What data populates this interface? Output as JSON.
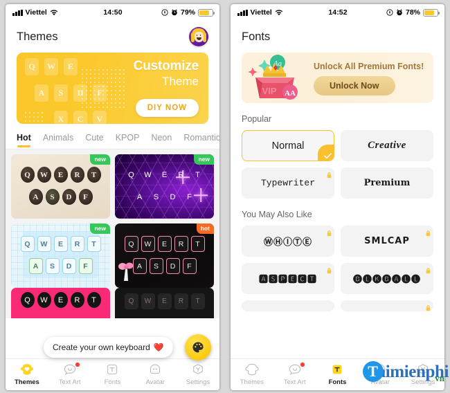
{
  "themes_screen": {
    "status_bar": {
      "carrier": "Viettel",
      "time": "14:50",
      "battery_pct": "79%",
      "icons": [
        "signal-bars-icon",
        "wifi-icon",
        "location-icon",
        "alarm-icon",
        "battery-icon"
      ]
    },
    "page_title": "Themes",
    "avatar_name": "user-avatar",
    "banner": {
      "title": "Customize",
      "subtitle": "Theme",
      "button": "DIY NOW",
      "keys_row1": [
        "Q",
        "W",
        "E"
      ],
      "keys_row2": [
        "A",
        "S",
        "D",
        "F"
      ],
      "keys_row3": [
        "X",
        "C",
        "V"
      ]
    },
    "category_tabs": [
      {
        "label": "Hot",
        "active": true
      },
      {
        "label": "Animals",
        "active": false
      },
      {
        "label": "Cute",
        "active": false
      },
      {
        "label": "KPOP",
        "active": false
      },
      {
        "label": "Neon",
        "active": false
      },
      {
        "label": "Romantic",
        "active": false
      }
    ],
    "theme_cards": [
      {
        "name": "typewriter-theme",
        "badge": "new",
        "row1": [
          "Q",
          "W",
          "E",
          "R",
          "T"
        ],
        "row2": [
          "A",
          "S",
          "D",
          "F"
        ]
      },
      {
        "name": "neon-purple-theme",
        "badge": "new",
        "row1": [
          "Q",
          "W",
          "E",
          "R",
          "T"
        ],
        "row2": [
          "A",
          "S",
          "D",
          "F"
        ]
      },
      {
        "name": "light-blue-theme",
        "badge": "new",
        "row1": [
          "Q",
          "W",
          "E",
          "R",
          "T"
        ],
        "row2": [
          "A",
          "S",
          "D",
          "F"
        ]
      },
      {
        "name": "black-pink-theme",
        "badge": "hot",
        "row1": [
          "Q",
          "W",
          "E",
          "R",
          "T"
        ],
        "row2": [
          "A",
          "S",
          "D",
          "F"
        ]
      },
      {
        "name": "pink-theme",
        "badge": "",
        "row1": [
          "Q",
          "W",
          "E",
          "R",
          "T"
        ],
        "row2": []
      },
      {
        "name": "dark-theme",
        "badge": "",
        "row1": [
          "Q",
          "W",
          "E",
          "R",
          "T"
        ],
        "row2": []
      }
    ],
    "tooltip": "Create your own keyboard",
    "tooltip_emoji": "❤️",
    "fab_name": "create-keyboard-fab"
  },
  "fonts_screen": {
    "status_bar": {
      "carrier": "Viettel",
      "time": "14:52",
      "battery_pct": "78%"
    },
    "page_title": "Fonts",
    "premium_banner": {
      "title": "Unlock All Premium Fonts!",
      "button": "Unlock Now",
      "box_label": "VIP",
      "badge_small": "Aa",
      "badge_pink": "AA"
    },
    "sections": [
      {
        "title": "Popular",
        "fonts": [
          {
            "label": "Normal",
            "style": "f-normal",
            "selected": true,
            "locked": false
          },
          {
            "label": "Creative",
            "style": "f-creative",
            "selected": false,
            "locked": false
          },
          {
            "label": "Typewriter",
            "style": "f-typewriter",
            "selected": false,
            "locked": true
          },
          {
            "label": "Premium",
            "style": "f-premium",
            "selected": false,
            "locked": false
          }
        ]
      },
      {
        "title": "You May Also Like",
        "fonts": [
          {
            "label": "ⓌⒽⒾⓉⒺ",
            "style": "f-mono",
            "selected": false,
            "locked": true
          },
          {
            "label": "SMLCAP",
            "style": "f-mono",
            "selected": false,
            "locked": true
          },
          {
            "label": "🅰🆂🅿🅴🅲🆃",
            "style": "f-mono",
            "selected": false,
            "locked": true
          },
          {
            "label": "🅑🅛🅚🅑🅐🅛🅛",
            "style": "f-mono",
            "selected": false,
            "locked": true
          }
        ]
      }
    ]
  },
  "bottom_nav_left": [
    {
      "label": "Themes",
      "icon": "themes-icon",
      "active": true,
      "dot": false
    },
    {
      "label": "Text Art",
      "icon": "text-art-icon",
      "active": false,
      "dot": true
    },
    {
      "label": "Fonts",
      "icon": "fonts-icon",
      "active": false,
      "dot": false
    },
    {
      "label": "Avatar",
      "icon": "avatar-icon",
      "active": false,
      "dot": false
    },
    {
      "label": "Settings",
      "icon": "settings-icon",
      "active": false,
      "dot": false
    }
  ],
  "bottom_nav_right": [
    {
      "label": "Themes",
      "icon": "themes-icon",
      "active": false,
      "dot": false
    },
    {
      "label": "Text Art",
      "icon": "text-art-icon",
      "active": false,
      "dot": true
    },
    {
      "label": "Fonts",
      "icon": "fonts-icon",
      "active": true,
      "dot": false
    },
    {
      "label": "Avatar",
      "icon": "avatar-icon",
      "active": false,
      "dot": false
    },
    {
      "label": "Settings",
      "icon": "settings-icon",
      "active": false,
      "dot": false
    }
  ],
  "watermark": {
    "logo_letter": "T",
    "text": "aimienphi",
    "suffix": "vn"
  },
  "colors": {
    "accent_yellow": "#fbc02d",
    "badge_new_green": "#35c759",
    "badge_hot_orange": "#f86a24",
    "red_dot": "#ff3b30",
    "premium_gold": "#a4763a"
  }
}
